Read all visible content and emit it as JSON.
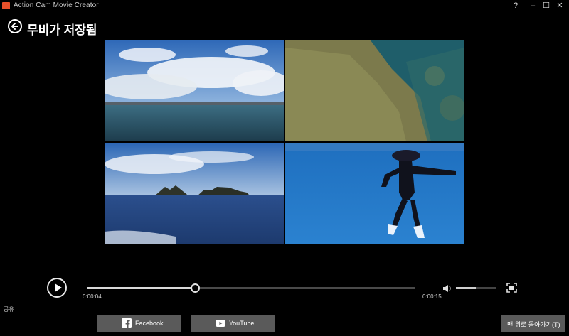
{
  "window": {
    "title": "Action Cam Movie Creator",
    "controls": {
      "help": "?",
      "minimize": "–",
      "maximize": "☐",
      "close": "✕"
    }
  },
  "header": {
    "title": "무비가 저장됨"
  },
  "player": {
    "current_time": "0:00:04",
    "total_time": "0:00:15",
    "progress": 0.33,
    "volume": 0.5
  },
  "share": {
    "label": "공유",
    "buttons": [
      {
        "label": "Facebook",
        "icon": "facebook-icon"
      },
      {
        "label": "YouTube",
        "icon": "youtube-icon"
      }
    ]
  },
  "footer": {
    "back_to_top": "맨 위로 돌아가기(T)"
  },
  "colors": {
    "accent": "#e8502a",
    "button_bg": "#5a5a5a",
    "background": "#000000"
  }
}
